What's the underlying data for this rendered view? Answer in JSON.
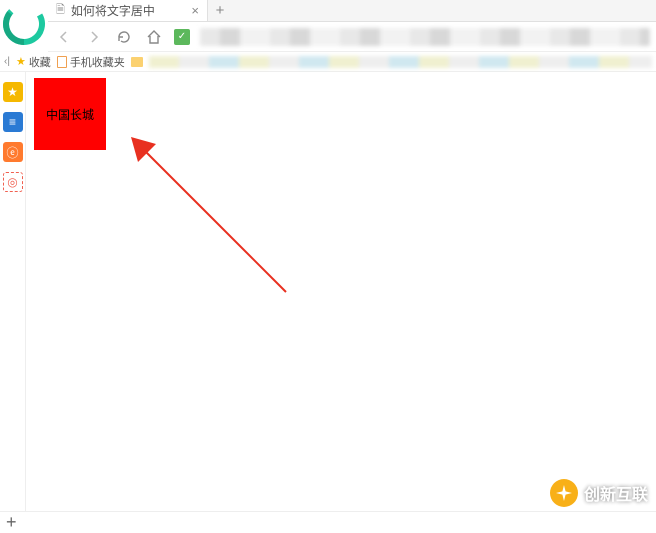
{
  "tab": {
    "title": "如何将文字居中",
    "close_glyph": "×",
    "new_tab_glyph": "+"
  },
  "bookmarks": {
    "collapse_glyph": "‹|",
    "favorites_label": "收藏",
    "mobile_label": "手机收藏夹"
  },
  "sidebar": {
    "fav_glyph": "★",
    "news_glyph": "≡",
    "weibo_glyph": "ⓔ",
    "target_glyph": "◎"
  },
  "page": {
    "red_box_text": "中国长城"
  },
  "statusbar": {
    "add_glyph": "+"
  },
  "watermark": {
    "text": "创新互联"
  }
}
